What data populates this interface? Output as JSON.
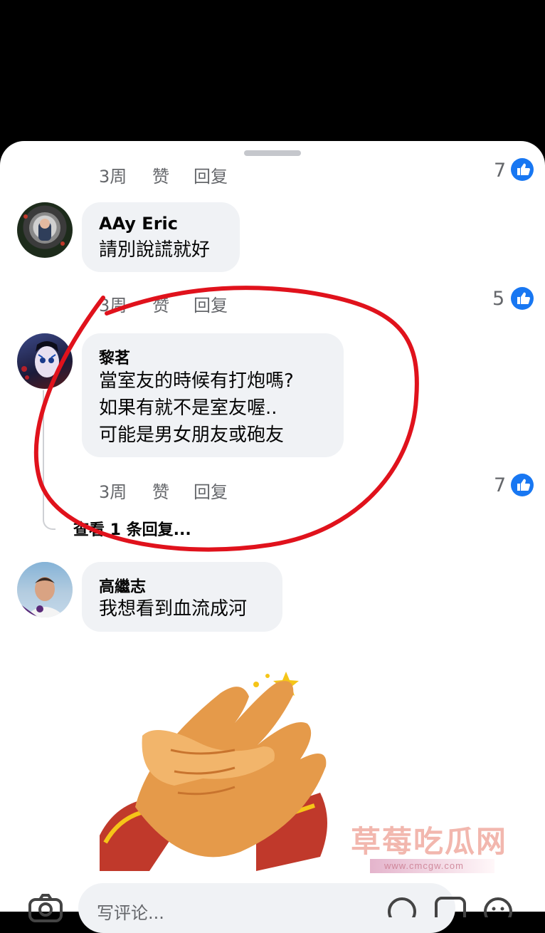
{
  "comments": [
    {
      "meta": {
        "time": "3周",
        "like": "赞",
        "reply": "回复"
      },
      "reaction_count": "7"
    },
    {
      "author": "AAy Eric",
      "text": "請別說謊就好",
      "meta": {
        "time": "3周",
        "like": "赞",
        "reply": "回复"
      },
      "reaction_count": "5"
    },
    {
      "author": "黎茗",
      "text_lines": [
        "當室友的時候有打炮嗎?",
        "如果有就不是室友喔..",
        "可能是男女朋友或砲友"
      ],
      "meta": {
        "time": "3周",
        "like": "赞",
        "reply": "回复"
      },
      "reaction_count": "7",
      "view_replies": "查看 1 条回复..."
    },
    {
      "author": "高繼志",
      "text": "我想看到血流成河"
    }
  ],
  "composer": {
    "placeholder": "写评论..."
  },
  "watermark": {
    "text": "草莓吃瓜网",
    "url": "www.cmcgw.com"
  },
  "colors": {
    "accent": "#1877f2",
    "bubble": "#f0f2f5",
    "annotation": "#e0121c"
  },
  "icons": [
    "like-icon",
    "camera-icon",
    "sticker-icon",
    "gif-icon",
    "emoji-icon"
  ]
}
